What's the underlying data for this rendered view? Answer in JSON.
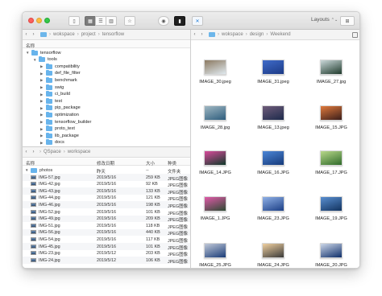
{
  "toolbar": {
    "layouts_label": "Layouts"
  },
  "left_top": {
    "path": [
      "wokspace",
      "project",
      "tensorflow"
    ],
    "column_header": "名称",
    "tree": [
      {
        "label": "tensorflow",
        "level": 0,
        "expanded": true
      },
      {
        "label": "tools",
        "level": 1,
        "expanded": true
      },
      {
        "label": "compatibility",
        "level": 2
      },
      {
        "label": "def_file_filter",
        "level": 2
      },
      {
        "label": "benchmark",
        "level": 2
      },
      {
        "label": "swig",
        "level": 2
      },
      {
        "label": "ci_build",
        "level": 2
      },
      {
        "label": "test",
        "level": 2
      },
      {
        "label": "pip_package",
        "level": 2
      },
      {
        "label": "optimization",
        "level": 2
      },
      {
        "label": "tensorflow_builder",
        "level": 2
      },
      {
        "label": "proto_text",
        "level": 2
      },
      {
        "label": "lib_package",
        "level": 2
      },
      {
        "label": "docs",
        "level": 2
      }
    ]
  },
  "left_bottom": {
    "path": [
      "QSpace",
      "workspace"
    ],
    "columns": [
      "名称",
      "修改日期",
      "大小",
      "种类"
    ],
    "folder": {
      "name": "photos",
      "date": "昨天",
      "size": "--",
      "kind": "文件夹"
    },
    "files": [
      {
        "name": "IMG-57.jpg",
        "date": "2019/5/16",
        "size": "259 KB",
        "kind": "JPEG图像"
      },
      {
        "name": "IMG-42.jpg",
        "date": "2019/5/16",
        "size": "92 KB",
        "kind": "JPEG图像"
      },
      {
        "name": "IMG-43.jpg",
        "date": "2019/5/16",
        "size": "133 KB",
        "kind": "JPEG图像"
      },
      {
        "name": "IMG-44.jpg",
        "date": "2019/5/16",
        "size": "121 KB",
        "kind": "JPEG图像"
      },
      {
        "name": "IMG-46.jpg",
        "date": "2019/5/16",
        "size": "198 KB",
        "kind": "JPEG图像"
      },
      {
        "name": "IMG-52.jpg",
        "date": "2019/5/16",
        "size": "101 KB",
        "kind": "JPEG图像"
      },
      {
        "name": "IMG-49.jpg",
        "date": "2019/5/16",
        "size": "209 KB",
        "kind": "JPEG图像"
      },
      {
        "name": "IMG-51.jpg",
        "date": "2019/5/16",
        "size": "118 KB",
        "kind": "JPEG图像"
      },
      {
        "name": "IMG-56.jpg",
        "date": "2019/5/16",
        "size": "440 KB",
        "kind": "JPEG图像"
      },
      {
        "name": "IMG-54.jpg",
        "date": "2019/5/16",
        "size": "117 KB",
        "kind": "JPEG图像"
      },
      {
        "name": "IMG-45.jpg",
        "date": "2019/5/16",
        "size": "101 KB",
        "kind": "JPEG图像"
      },
      {
        "name": "IMG-23.jpg",
        "date": "2019/5/12",
        "size": "203 KB",
        "kind": "JPEG图像"
      },
      {
        "name": "IMG-24.jpg",
        "date": "2019/5/12",
        "size": "106 KB",
        "kind": "JPEG图像"
      }
    ]
  },
  "right": {
    "path": [
      "wokspace",
      "design",
      "Weekend"
    ],
    "images": [
      {
        "name": "IMAGE_30.jpeg",
        "colors": [
          "#dfe8ee",
          "#8c7a62"
        ]
      },
      {
        "name": "IMAGE_31.jpeg",
        "colors": [
          "#1c3a86",
          "#3f6bc9"
        ]
      },
      {
        "name": "IMAGE_27.jpg",
        "colors": [
          "#1f3a2c",
          "#c9d7d8"
        ]
      },
      {
        "name": "IMAGE_28.jpg",
        "colors": [
          "#2d5d7d",
          "#9fb7c2"
        ]
      },
      {
        "name": "IMAGE_13.jpeg",
        "colors": [
          "#1d2a4b",
          "#6f5c7a"
        ]
      },
      {
        "name": "IMAGE_15.JPG",
        "colors": [
          "#3a1d1a",
          "#e07a3c"
        ]
      },
      {
        "name": "IMAGE_14.JPG",
        "colors": [
          "#0f3a2a",
          "#d84a9a"
        ]
      },
      {
        "name": "IMAGE_16.JPG",
        "colors": [
          "#163a7a",
          "#4b86d6"
        ]
      },
      {
        "name": "IMAGE_17.JPG",
        "colors": [
          "#2f6a2a",
          "#b8d88a"
        ]
      },
      {
        "name": "IMAGE_1.JPG",
        "colors": [
          "#2d4a33",
          "#e05aa8"
        ]
      },
      {
        "name": "IMAGE_23.JPG",
        "colors": [
          "#1c3f86",
          "#8fb0e6"
        ]
      },
      {
        "name": "IMAGE_19.JPG",
        "colors": [
          "#12335f",
          "#5a8fd0"
        ]
      },
      {
        "name": "IMAGE_25.JPG",
        "colors": [
          "#1a3c78",
          "#c0c8d8"
        ]
      },
      {
        "name": "IMAGE_24.JPG",
        "colors": [
          "#3a3a3a",
          "#f0d0a0"
        ]
      },
      {
        "name": "IMAGE_20.JPG",
        "colors": [
          "#0f2f6a",
          "#cbd6e8"
        ]
      }
    ]
  }
}
